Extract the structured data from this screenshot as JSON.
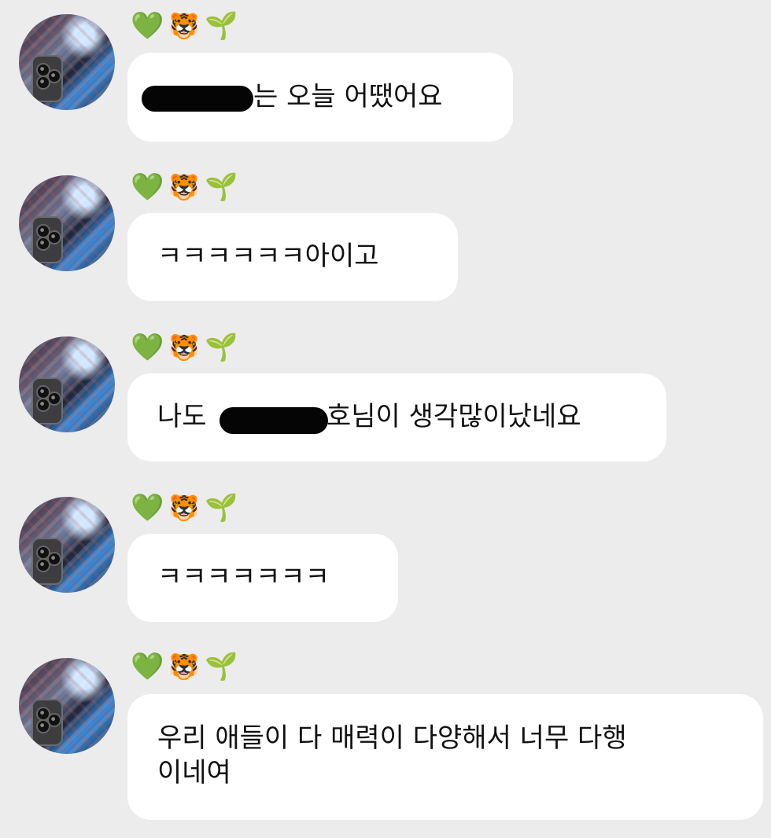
{
  "messages": [
    {
      "emojis": [
        "💚",
        "🐯",
        "🌱"
      ],
      "text_after_redaction": "는 오늘 어땠어요"
    },
    {
      "emojis": [
        "💚",
        "🐯",
        "🌱"
      ],
      "text": "ㅋㅋㅋㅋㅋㅋ아이고"
    },
    {
      "emojis": [
        "💚",
        "🐯",
        "🌱"
      ],
      "text_before_redaction": "나도",
      "text_after_redaction": "호님이 생각많이났네요"
    },
    {
      "emojis": [
        "💚",
        "🐯",
        "🌱"
      ],
      "text": "ㅋㅋㅋㅋㅋㅋㅋ"
    },
    {
      "emojis": [
        "💚",
        "🐯",
        "🌱"
      ],
      "text": "우리 애들이 다 매력이 다양해서 너무 다행\n이네여"
    }
  ],
  "icons": {
    "avatar": "profile-photo",
    "emoji_1": "green-heart-icon",
    "emoji_2": "tiger-face-icon",
    "emoji_3": "seedling-icon",
    "redaction": "black-redaction-bar"
  },
  "colors": {
    "background": "#ececec",
    "bubble": "#ffffff",
    "text": "#111111",
    "redaction": "#050505"
  }
}
